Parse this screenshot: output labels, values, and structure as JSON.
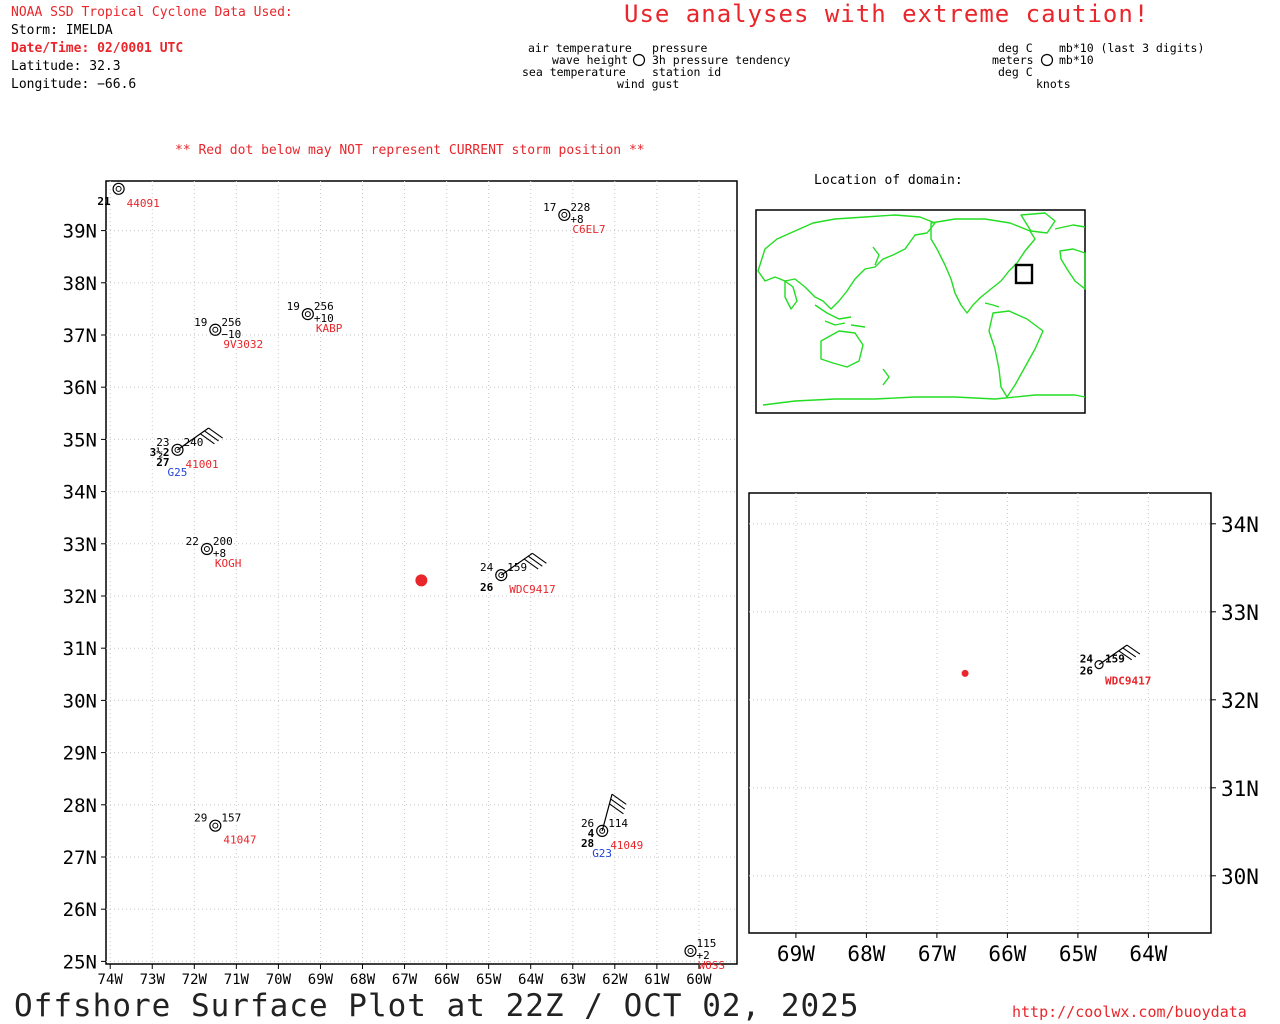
{
  "header": {
    "source": "NOAA SSD Tropical Cyclone Data Used:",
    "storm": "Storm: IMELDA",
    "datetime": "Date/Time: 02/0001 UTC",
    "latitude": "Latitude: 32.3",
    "longitude": "Longitude: −66.6"
  },
  "caution": "Use analyses with extreme caution!",
  "legend": {
    "left": {
      "air_temperature": "air temperature",
      "wave_height": "wave height",
      "sea_temperature": "sea temperature",
      "pressure": "pressure",
      "tendency": "3h pressure tendency",
      "station_id": "station id",
      "wind_gust": "wind gust"
    },
    "right": {
      "deg_c_1": "deg C",
      "meters": "meters",
      "deg_c_2": "deg C",
      "mb_last3": "mb*10 (last 3 digits)",
      "mb10": "mb*10",
      "knots": "knots"
    }
  },
  "red_dot_note": "** Red dot below may NOT represent CURRENT storm position **",
  "location_label": "Location of domain:",
  "main_map": {
    "lat_labels": [
      "39N",
      "38N",
      "37N",
      "36N",
      "35N",
      "34N",
      "33N",
      "32N",
      "31N",
      "30N",
      "29N",
      "28N",
      "27N",
      "26N",
      "25N"
    ],
    "lon_labels": [
      "74W",
      "73W",
      "72W",
      "71W",
      "70W",
      "69W",
      "68W",
      "67W",
      "66W",
      "65W",
      "64W",
      "63W",
      "62W",
      "61W",
      "60W"
    ],
    "storm_position": {
      "lat": 32.3,
      "lon": -66.6
    },
    "stations": [
      {
        "id": "44091",
        "id_color": "#e8262b",
        "lat": 39.8,
        "lon": -73.8,
        "air_temp": "",
        "pressure": "",
        "tendency": "",
        "sea_temp": "21",
        "wave": ""
      },
      {
        "id": "C6EL7",
        "id_color": "#e8262b",
        "lat": 39.3,
        "lon": -63.2,
        "air_temp": "17",
        "pressure": "228",
        "tendency": "+8",
        "sea_temp": "",
        "wave": ""
      },
      {
        "id": "9V3032",
        "id_color": "#e8262b",
        "lat": 37.1,
        "lon": -71.5,
        "air_temp": "19",
        "pressure": "256",
        "tendency": "−10",
        "sea_temp": "",
        "wave": ""
      },
      {
        "id": "KABP",
        "id_color": "#e8262b",
        "lat": 37.4,
        "lon": -69.3,
        "air_temp": "19",
        "pressure": "256",
        "tendency": "+10",
        "sea_temp": "",
        "wave": ""
      },
      {
        "id": "41001",
        "id_color": "#e8262b",
        "lat": 34.8,
        "lon": -72.4,
        "air_temp": "23",
        "pressure": "240",
        "tendency": "",
        "sea_temp": "27",
        "wave": "3½2",
        "gust": "G25"
      },
      {
        "id": "KOGH",
        "id_color": "#e8262b",
        "lat": 32.9,
        "lon": -71.7,
        "air_temp": "22",
        "pressure": "200",
        "tendency": "+8",
        "sea_temp": "",
        "wave": ""
      },
      {
        "id": "WDC9417",
        "id_color": "#e8262b",
        "lat": 32.4,
        "lon": -64.7,
        "air_temp": "24",
        "pressure": "159",
        "tendency": "",
        "sea_temp": "26",
        "wave": ""
      },
      {
        "id": "41047",
        "id_color": "#e8262b",
        "lat": 27.6,
        "lon": -71.5,
        "air_temp": "29",
        "pressure": "157",
        "tendency": "",
        "sea_temp": "",
        "wave": ""
      },
      {
        "id": "41049",
        "id_color": "#e8262b",
        "lat": 27.5,
        "lon": -62.3,
        "air_temp": "26",
        "pressure": "114",
        "tendency": "",
        "sea_temp": "28",
        "wave": "4",
        "gust": "G23"
      },
      {
        "id": "WOSS",
        "id_color": "#e8262b",
        "lat": 25.2,
        "lon": -60.2,
        "air_temp": "",
        "pressure": "115",
        "tendency": "+2",
        "sea_temp": "",
        "wave": ""
      }
    ]
  },
  "inset_map": {
    "lat_labels": [
      "34N",
      "33N",
      "32N",
      "31N",
      "30N"
    ],
    "lon_labels": [
      "69W",
      "68W",
      "67W",
      "66W",
      "65W",
      "64W"
    ],
    "storm_position": {
      "lat": 32.3,
      "lon": -66.6
    },
    "stations": [
      {
        "id": "WDC9417",
        "lat": 32.4,
        "lon": -64.7,
        "air_temp": "24",
        "pressure": "159",
        "sea_temp": "26"
      }
    ]
  },
  "footer": {
    "title": "Offshore Surface Plot at 22Z / OCT 02, 2025",
    "url": "http://coolwx.com/buoydata"
  }
}
